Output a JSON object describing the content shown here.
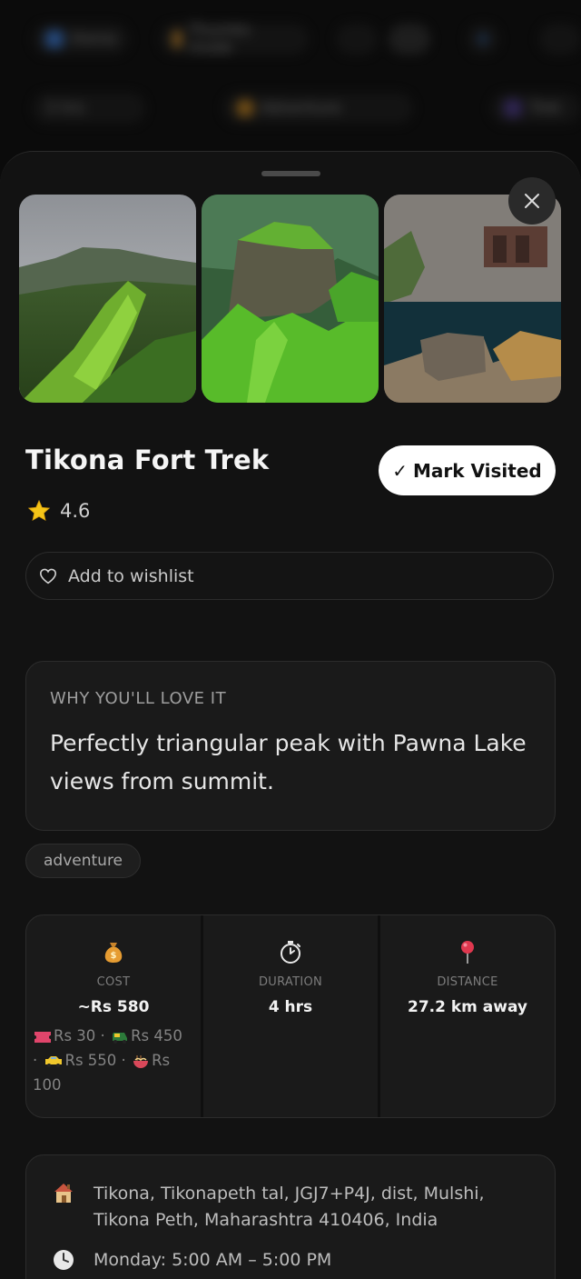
{
  "background": {
    "row1": [
      "Home",
      "Thumbs mode"
    ],
    "row2": [
      "3 hrs",
      "Adventure",
      "Trek"
    ]
  },
  "place": {
    "name": "Tikona Fort Trek",
    "rating": "4.6",
    "mark_visited": "Mark Visited",
    "wishlist": "Add to wishlist"
  },
  "why": {
    "title": "WHY YOU'LL LOVE IT",
    "text": "Perfectly triangular peak with Pawna Lake views from summit."
  },
  "tags": [
    "adventure"
  ],
  "stats": {
    "cost": {
      "icon": "money-bag-icon",
      "label": "COST",
      "value": "~Rs 580",
      "breakdown": [
        {
          "icon": "ticket-icon",
          "text": "Rs 30"
        },
        {
          "icon": "auto-rickshaw-icon",
          "text": "Rs 450"
        },
        {
          "icon": "taxi-icon",
          "text": "Rs 550"
        },
        {
          "icon": "noodle-bowl-icon",
          "text": "Rs 100"
        }
      ]
    },
    "duration": {
      "icon": "stopwatch-icon",
      "label": "DURATION",
      "value": "4 hrs"
    },
    "distance": {
      "icon": "map-pin-icon",
      "label": "DISTANCE",
      "value": "27.2 km away"
    }
  },
  "address": {
    "text": "Tikona, Tikonapeth tal, JGJ7+P4J, dist, Mulshi, Tikona Peth, Maharashtra 410406, India",
    "hours": "Monday: 5:00 AM – 5:00 PM"
  },
  "colors": {
    "sheet": "#121212",
    "card": "#1a1a1a",
    "star": "#f5c518",
    "accent_white": "#ffffff"
  }
}
